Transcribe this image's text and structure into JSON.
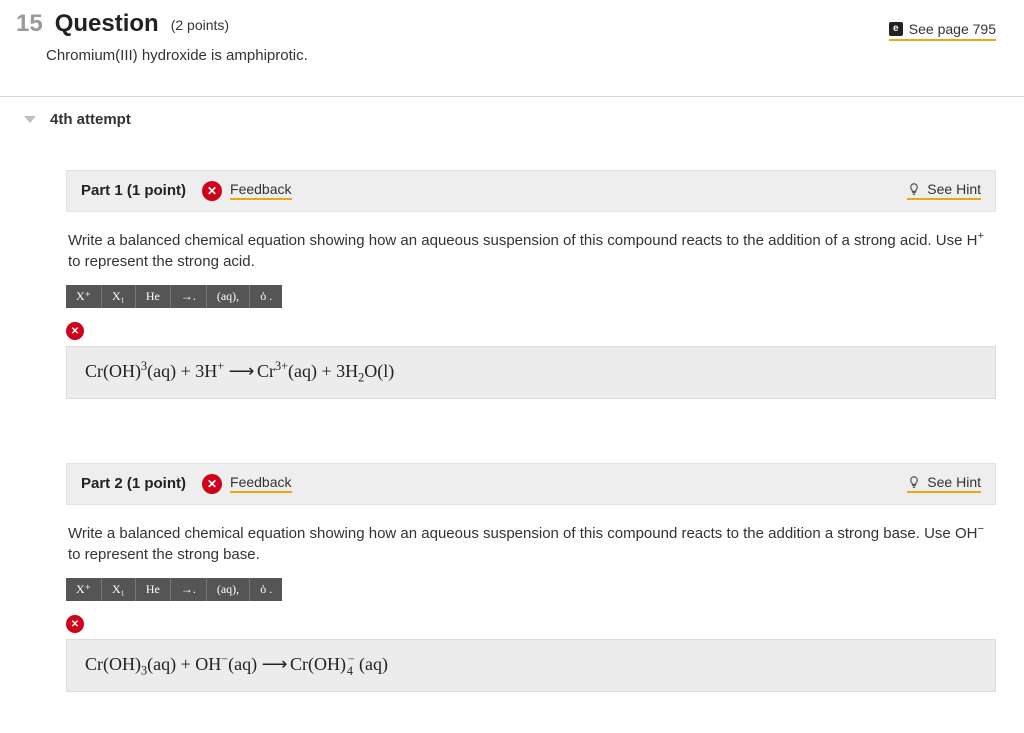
{
  "header": {
    "number": "15",
    "word": "Question",
    "points": "(2 points)",
    "see_page": "See page 795",
    "body": "Chromium(III) hydroxide is amphiprotic."
  },
  "attempt": {
    "label": "4th attempt"
  },
  "toolbar": {
    "b1": "X⁺",
    "b2": "X₁",
    "b3": "He",
    "b4": "→.",
    "b5": "(aq),",
    "b6": "ὀ ."
  },
  "part1": {
    "title": "Part 1   (1 point)",
    "feedback": "Feedback",
    "hint": "See Hint",
    "prompt_main": "Write a balanced chemical equation showing how an aqueous suspension of this compound reacts to the addition of a strong acid. Use ",
    "prompt_tail": " to represent the strong acid.",
    "ion": "H",
    "ion_sup": "+"
  },
  "part2": {
    "title": "Part 2   (1 point)",
    "feedback": "Feedback",
    "hint": "See Hint",
    "prompt_main": "Write a balanced chemical equation showing how an aqueous suspension of this compound reacts to the addition a strong base. Use ",
    "prompt_tail": " to represent the strong base.",
    "ion": "OH",
    "ion_sup": "−"
  },
  "eq1": {
    "a": "Cr(OH)",
    "a_sup": "3",
    "a_tail": "(aq) + 3H",
    "b_sup": "+",
    "arrow": " ⟶ ",
    "c": "Cr",
    "c_sup": "3+",
    "c_tail": "(aq) + 3H",
    "d_sub": "2",
    "d_tail": "O(l)"
  },
  "eq2": {
    "a": "Cr(OH)",
    "a_sub": "3",
    "a_tail": "(aq) + OH",
    "b_sup": "−",
    "b_tail": "(aq)",
    "arrow": " ⟶ ",
    "c": "Cr(OH)",
    "c_sup": "−",
    "c_sub": "4",
    "c_tail": "(aq)"
  }
}
